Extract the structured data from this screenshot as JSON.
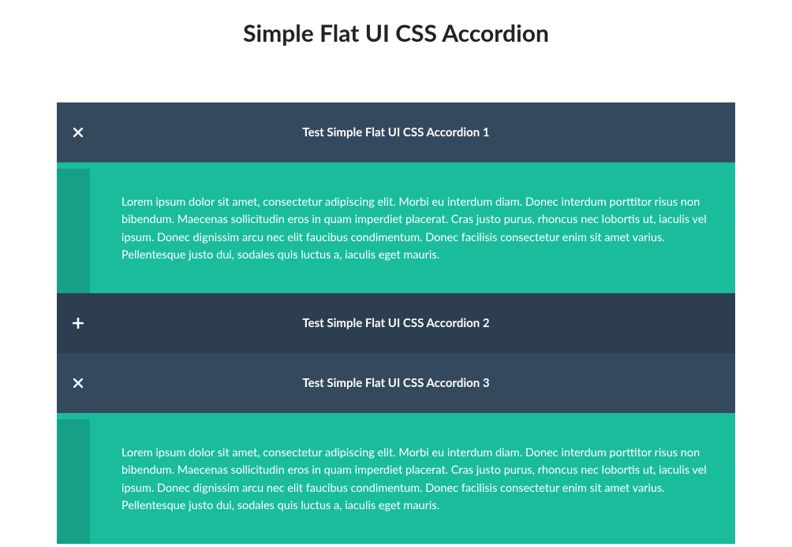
{
  "title": "Simple Flat UI CSS Accordion",
  "items": [
    {
      "label": "Test Simple Flat UI CSS Accordion 1",
      "open": true,
      "dark": false,
      "content": "Lorem ipsum dolor sit amet, consectetur adipiscing elit. Morbi eu interdum diam. Donec interdum porttitor risus non bibendum. Maecenas sollicitudin eros in quam imperdiet placerat. Cras justo purus, rhoncus nec lobortis ut, iaculis vel ipsum. Donec dignissim arcu nec elit faucibus condimentum. Donec facilisis consectetur enim sit amet varius. Pellentesque justo dui, sodales quis luctus a, iaculis eget mauris."
    },
    {
      "label": "Test Simple Flat UI CSS Accordion 2",
      "open": false,
      "dark": true,
      "content": ""
    },
    {
      "label": "Test Simple Flat UI CSS Accordion 3",
      "open": true,
      "dark": false,
      "content": "Lorem ipsum dolor sit amet, consectetur adipiscing elit. Morbi eu interdum diam. Donec interdum porttitor risus non bibendum. Maecenas sollicitudin eros in quam imperdiet placerat. Cras justo purus, rhoncus nec lobortis ut, iaculis vel ipsum. Donec dignissim arcu nec elit faucibus condimentum. Donec facilisis consectetur enim sit amet varius. Pellentesque justo dui, sodales quis luctus a, iaculis eget mauris."
    }
  ]
}
